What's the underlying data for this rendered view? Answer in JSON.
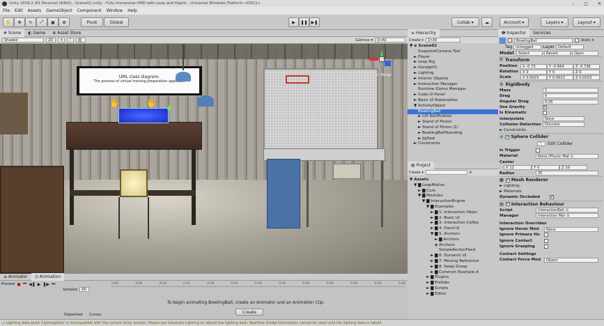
{
  "window": {
    "title": "Unity 2018.2.0f1 Personal (64bit) - Scene02.unity - Fully Immersive HMD with Leap and Haptic - Universal Windows Platform <DX11>",
    "controls": [
      "–",
      "□",
      "✕"
    ]
  },
  "menu": [
    "File",
    "Edit",
    "Assets",
    "GameObject",
    "Component",
    "Window",
    "Help"
  ],
  "toolbar": {
    "pivot": "Pivot",
    "global": "Global",
    "collab": "Collab ▾",
    "account": "Account ▾",
    "layers": "Layers ▾",
    "layout": "Layout ▾"
  },
  "scene_tabs": [
    "# Scene",
    "◐ Game",
    "⊕ Asset Store"
  ],
  "scene_bar": {
    "shaded": "Shaded",
    "mode2d": "2D",
    "gizmos": "Gizmos ▾",
    "search": "Q•All"
  },
  "scene": {
    "board_line1": "UML class diagram.",
    "board_line2": "The process of virtual training preparation approach",
    "persp": "< Persp"
  },
  "hierarchy": {
    "tab": "≡ Hierarchy",
    "create": "Create ▾",
    "search": "Q•All",
    "items": [
      {
        "t": "▼ ◈ Scene02",
        "d": 0,
        "b": 1,
        "s": 0
      },
      {
        "t": "SnapshotCamera Tool",
        "d": 2,
        "b": 0,
        "s": 0
      },
      {
        "t": "► Player",
        "d": 1,
        "b": 0,
        "s": 0
      },
      {
        "t": "► Leap Rig",
        "d": 1,
        "b": 0,
        "s": 0
      },
      {
        "t": "► Garage01",
        "d": 1,
        "b": 0,
        "s": 0
      },
      {
        "t": "► Lighting",
        "d": 1,
        "b": 0,
        "s": 0
      },
      {
        "t": "► Interior Objects",
        "d": 1,
        "b": 0,
        "s": 0
      },
      {
        "t": "► Interaction Manager",
        "d": 1,
        "b": 0,
        "s": 0
      },
      {
        "t": "Runtime Gizmo Manager",
        "d": 2,
        "b": 0,
        "s": 0
      },
      {
        "t": "► Cube UI Panel",
        "d": 1,
        "b": 0,
        "s": 0
      },
      {
        "t": "► Basic UI Explanation",
        "d": 1,
        "b": 0,
        "s": 0
      },
      {
        "t": "▼ ActivityObject",
        "d": 1,
        "b": 0,
        "s": 0
      },
      {
        "t": "BowlingBall",
        "d": 2,
        "b": 0,
        "s": 1
      },
      {
        "t": "► Lift Notification",
        "d": 2,
        "b": 0,
        "s": 0
      },
      {
        "t": "► Stand of Pinion",
        "d": 2,
        "b": 0,
        "s": 0
      },
      {
        "t": "► Stand of Pinion (1)",
        "d": 2,
        "b": 0,
        "s": 0
      },
      {
        "t": "► BowlingBallStanding",
        "d": 2,
        "b": 0,
        "s": 0
      },
      {
        "t": "► JigSaw",
        "d": 2,
        "b": 0,
        "s": 0
      },
      {
        "t": "► Constraints",
        "d": 1,
        "b": 0,
        "s": 0
      }
    ]
  },
  "project": {
    "tab": "▤ Project",
    "create": "Create ▾",
    "count": "4",
    "items": [
      {
        "t": "▼ Assets",
        "d": 0,
        "b": 1
      },
      {
        "t": "▼ ▇ LeapMotion",
        "d": 1,
        "b": 0
      },
      {
        "t": "► ▇ Core",
        "d": 2,
        "b": 0
      },
      {
        "t": "▼ ▇ Modules",
        "d": 2,
        "b": 0
      },
      {
        "t": "▼ ▇ InteractionEngine",
        "d": 3,
        "b": 0
      },
      {
        "t": "▼ ▇ Examples",
        "d": 4,
        "b": 0
      },
      {
        "t": "► ▇ 1. Interaction Objec",
        "d": 5,
        "b": 0
      },
      {
        "t": "► ▇ 2. Basic UI",
        "d": 5,
        "b": 0
      },
      {
        "t": "► ▇ 3. Interaction Callba",
        "d": 5,
        "b": 0
      },
      {
        "t": "► ▇ 4. Hand UI",
        "d": 5,
        "b": 0
      },
      {
        "t": "▼ ▇ 5. Anchors",
        "d": 5,
        "b": 0
      },
      {
        "t": "► ▇ Anchors",
        "d": 6,
        "b": 0
      },
      {
        "t": "◈ Anchors",
        "d": 6,
        "b": 0
      },
      {
        "t": "SimpleAnchorFeed",
        "d": 7,
        "b": 0
      },
      {
        "t": "► ▇ 6. Dynamic UI",
        "d": 5,
        "b": 0
      },
      {
        "t": "► ▇ 7. Moving Reference",
        "d": 5,
        "b": 0
      },
      {
        "t": "► ▇ 8. Swap Grasp",
        "d": 5,
        "b": 0
      },
      {
        "t": "► ▇ Common Example A",
        "d": 5,
        "b": 0
      },
      {
        "t": "► ▇ Plugins",
        "d": 4,
        "b": 0
      },
      {
        "t": "► ▇ Prefabs",
        "d": 4,
        "b": 0
      },
      {
        "t": "► ▇ Scripts",
        "d": 4,
        "b": 0
      },
      {
        "t": "► ▇ Editor",
        "d": 4,
        "b": 0
      }
    ]
  },
  "inspector": {
    "tabs": [
      "❶ Inspector",
      "Services"
    ],
    "name": "BowlingBall",
    "static": "Static ▾",
    "tag_label": "Tag",
    "tag": "Untagged",
    "layer_label": "Layer",
    "layer": "Default",
    "model_label": "Model",
    "model_btns": [
      "Select",
      "Revert",
      "Open"
    ],
    "transform": {
      "title": "Transform",
      "pos": {
        "label": "Position",
        "x": "X -0.73",
        "y": "Y -0.564",
        "z": "Z -0.736"
      },
      "rot": {
        "label": "Rotation",
        "x": "X 0",
        "y": "Y 0",
        "z": "Z 0"
      },
      "scale": {
        "label": "Scale",
        "x": "X 0.0023",
        "y": "Y 0.0023",
        "z": "Z 0.0023"
      }
    },
    "rigidbody": {
      "title": "Rigidbody",
      "rows": [
        {
          "l": "Mass",
          "v": "1",
          "k": "f"
        },
        {
          "l": "Drag",
          "v": "0",
          "k": "f"
        },
        {
          "l": "Angular Drag",
          "v": "0.05",
          "k": "f"
        },
        {
          "l": "Use Gravity",
          "v": "✔",
          "k": "c"
        },
        {
          "l": "Is Kinematic",
          "v": "",
          "k": "c"
        },
        {
          "l": "Interpolate",
          "v": "None",
          "k": "d"
        },
        {
          "l": "Collision Detection",
          "v": "Discrete",
          "k": "d"
        }
      ],
      "constraints": "► Constraints"
    },
    "sphere": {
      "title": "Sphere Collider",
      "edit": "Edit Collider",
      "is_trigger": "Is Trigger",
      "material_label": "Material",
      "material": "None (Physic Mat ⊙",
      "center_label": "Center",
      "cx": "X 12",
      "cy": "Y 0",
      "cz": "Z 10",
      "radius_label": "Radius",
      "radius": "35"
    },
    "mesh": {
      "title": "Mesh Renderer",
      "lighting": "► Lighting",
      "materials": "► Materials",
      "dyn": "Dynamic Occluded"
    },
    "ib": {
      "title": "Interaction Behaviour",
      "script_label": "Script",
      "script": "InteractionBeh ⊙",
      "manager_label": "Manager",
      "manager": "Interaction Mar ⊙",
      "overrides": "Interaction Overrides",
      "ihm": "Ignore Hover Mod",
      "ihm_v": "None",
      "iph": "Ignore Primary Ho",
      "icon": "Ignore Contact",
      "igr": "Ignore Grasping",
      "contact": "Contact Settings",
      "cfm": "Contact Force Mod",
      "cfm_v": "Object"
    }
  },
  "animator": {
    "tabs": [
      "≡ Animator",
      "◷ Animation"
    ],
    "preview": "Preview",
    "samples_label": "Samples",
    "samples": "60",
    "ticks": [
      "0:00",
      "0:05",
      "0:10",
      "0:15",
      "0:20",
      "0:25",
      "0:30",
      "0:35",
      "0:40",
      "0:45",
      "0:50",
      "0:55",
      "1:00"
    ],
    "dopesheet": "Dopesheet",
    "curves": "Curves",
    "msg": "To begin animating BowlingBall, create an Animator and an Animation Clip.",
    "create": "Create"
  },
  "status": "⚠ Lighting data asset 'LightingData' is incompatible with the current Unity version. Please use Generate Lighting to rebuild the lighting data. Realtime Global Illumination cannot be used until the lighting data is rebuilt.",
  "colors": {
    "selection": "#3a72d8",
    "chrome": "#c2c2c2",
    "status": "#d8b000"
  }
}
